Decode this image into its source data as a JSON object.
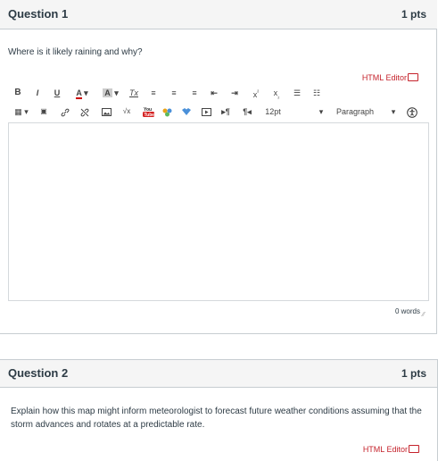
{
  "question1": {
    "title": "Question 1",
    "points": "1 pts",
    "text": "Where is it likely raining and why?",
    "html_editor_label": "HTML Editor",
    "font_size_label": "12pt",
    "paragraph_label": "Paragraph",
    "word_count": "0 words"
  },
  "question2": {
    "title": "Question 2",
    "points": "1 pts",
    "text": "Explain how this map might inform meteorologist to forecast future weather conditions assuming that the storm advances and rotates at a predictable rate.",
    "html_editor_label": "HTML Editor"
  },
  "toolbar": {
    "row1": [
      {
        "name": "bold-icon",
        "glyph": "B"
      },
      {
        "name": "italic-icon",
        "glyph": "I"
      },
      {
        "name": "underline-icon",
        "glyph": "U"
      },
      {
        "name": "text-color-icon",
        "glyph": "A"
      },
      {
        "name": "background-color-icon",
        "glyph": "A"
      },
      {
        "name": "clear-formatting-icon",
        "glyph": "Tx"
      },
      {
        "name": "align-left-icon",
        "glyph": "≡"
      },
      {
        "name": "align-center-icon",
        "glyph": "≡"
      },
      {
        "name": "align-right-icon",
        "glyph": "≡"
      },
      {
        "name": "outdent-icon",
        "glyph": "⇤"
      },
      {
        "name": "indent-icon",
        "glyph": "⇥"
      },
      {
        "name": "superscript-icon",
        "glyph": "x²"
      },
      {
        "name": "subscript-icon",
        "glyph": "x₂"
      },
      {
        "name": "bullet-list-icon",
        "glyph": "☰"
      },
      {
        "name": "numbered-list-icon",
        "glyph": "☰"
      }
    ],
    "row2": [
      {
        "name": "table-icon",
        "glyph": "▦"
      },
      {
        "name": "media-icon",
        "glyph": "▣"
      },
      {
        "name": "link-icon",
        "glyph": "🔗"
      },
      {
        "name": "unlink-icon",
        "glyph": "⚯"
      },
      {
        "name": "image-icon",
        "glyph": "▨"
      },
      {
        "name": "equation-icon",
        "glyph": "√x"
      },
      {
        "name": "youtube-icon",
        "glyph": "You Tube"
      },
      {
        "name": "apps-icon",
        "glyph": "❖"
      },
      {
        "name": "dropbox-icon",
        "glyph": "▾"
      },
      {
        "name": "video-icon",
        "glyph": "▷"
      },
      {
        "name": "ltr-icon",
        "glyph": "¶"
      },
      {
        "name": "rtl-icon",
        "glyph": "¶"
      }
    ]
  },
  "colors": {
    "header_bg": "#f5f5f5",
    "border": "#c7cdd1",
    "html_editor": "#c5232c",
    "text": "#2d3b45"
  }
}
